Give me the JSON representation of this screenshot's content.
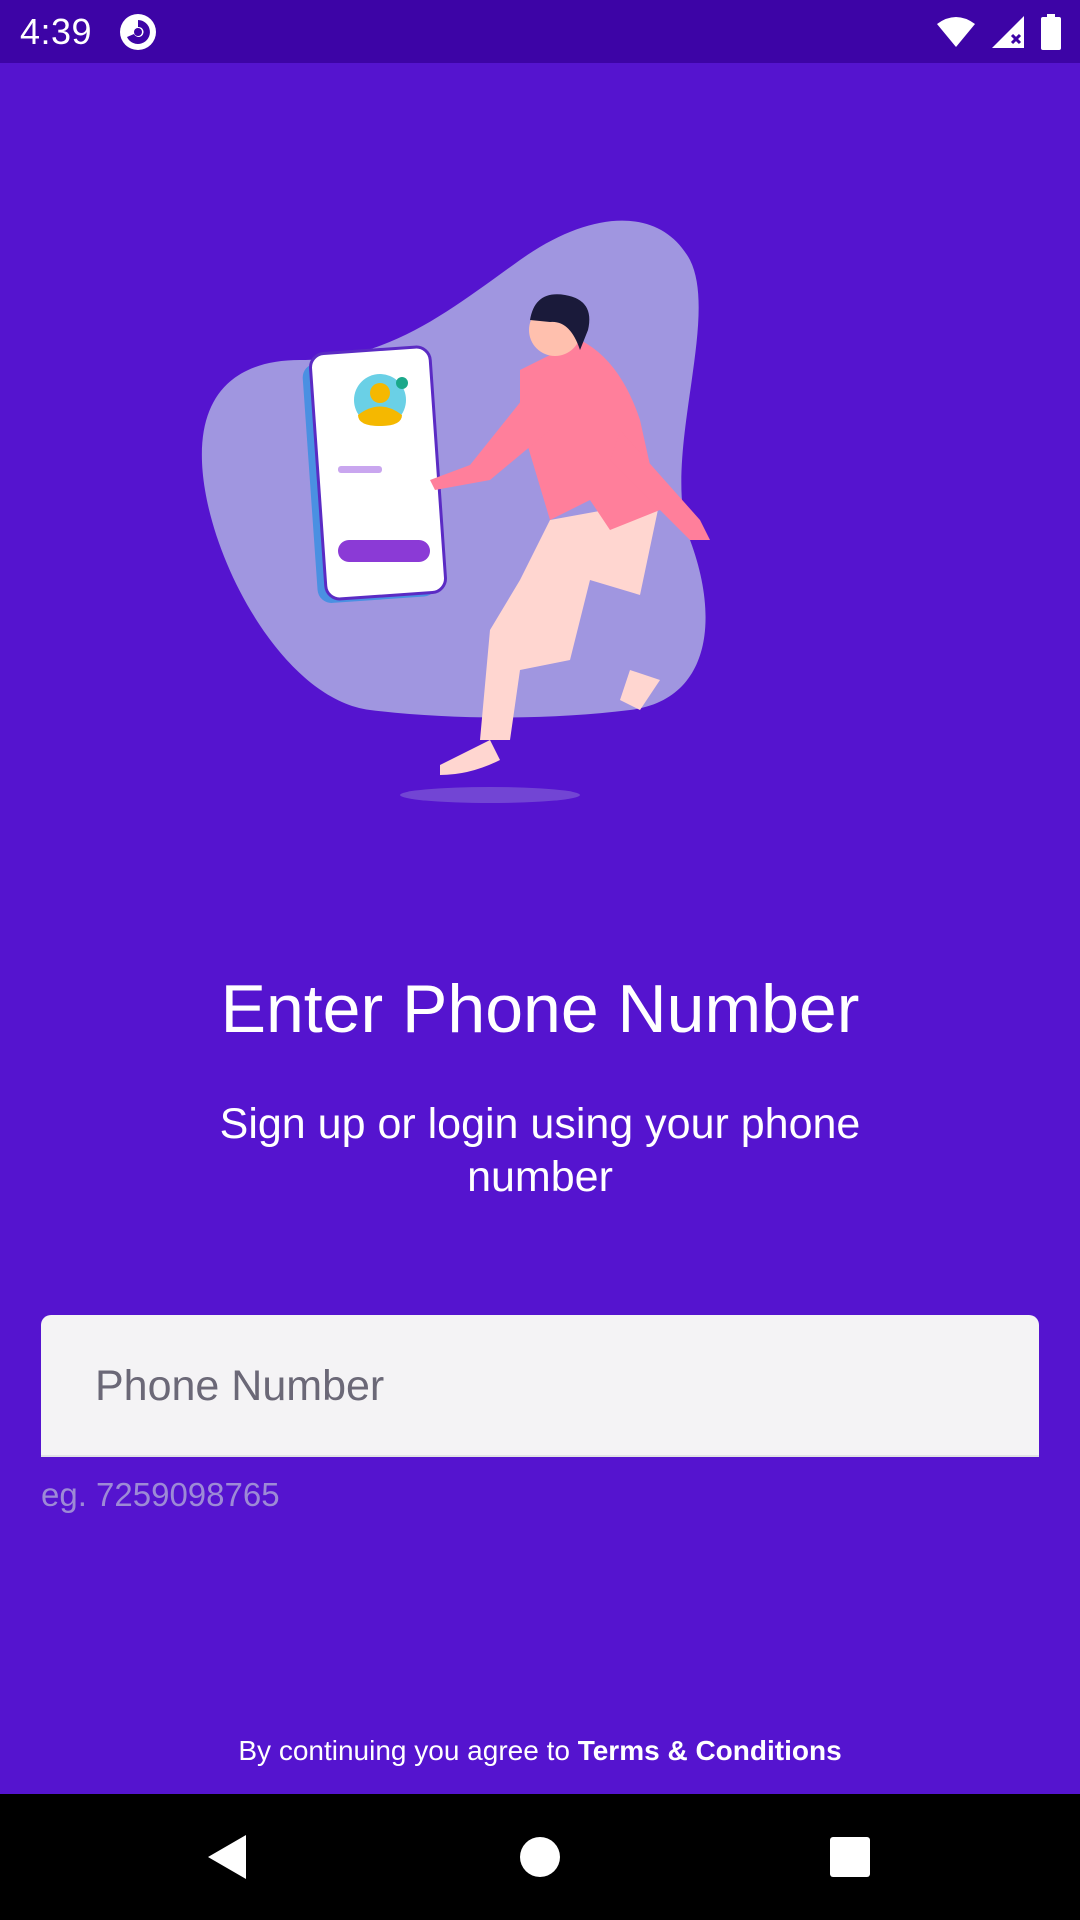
{
  "colors": {
    "background": "#5514cf",
    "status_bar": "#3d04a6",
    "field_background": "#f4f3f5",
    "helper_text": "#9d8ad6",
    "nav_bar": "#000000"
  },
  "status_bar": {
    "time": "4:39",
    "icons": [
      "app-notification-icon",
      "wifi-icon",
      "cellular-signal-icon",
      "battery-icon"
    ]
  },
  "illustration": {
    "icon": "phone-signup-illustration"
  },
  "main": {
    "title": "Enter Phone Number",
    "subtitle": "Sign up or login using your phone number"
  },
  "phone_input": {
    "placeholder": "Phone Number",
    "value": "",
    "helper": "eg. 7259098765"
  },
  "footer": {
    "terms_prefix": "By continuing you agree to ",
    "terms_link": "Terms & Conditions"
  },
  "nav_bar": {
    "buttons": [
      "back-icon",
      "home-icon",
      "recents-icon"
    ]
  }
}
